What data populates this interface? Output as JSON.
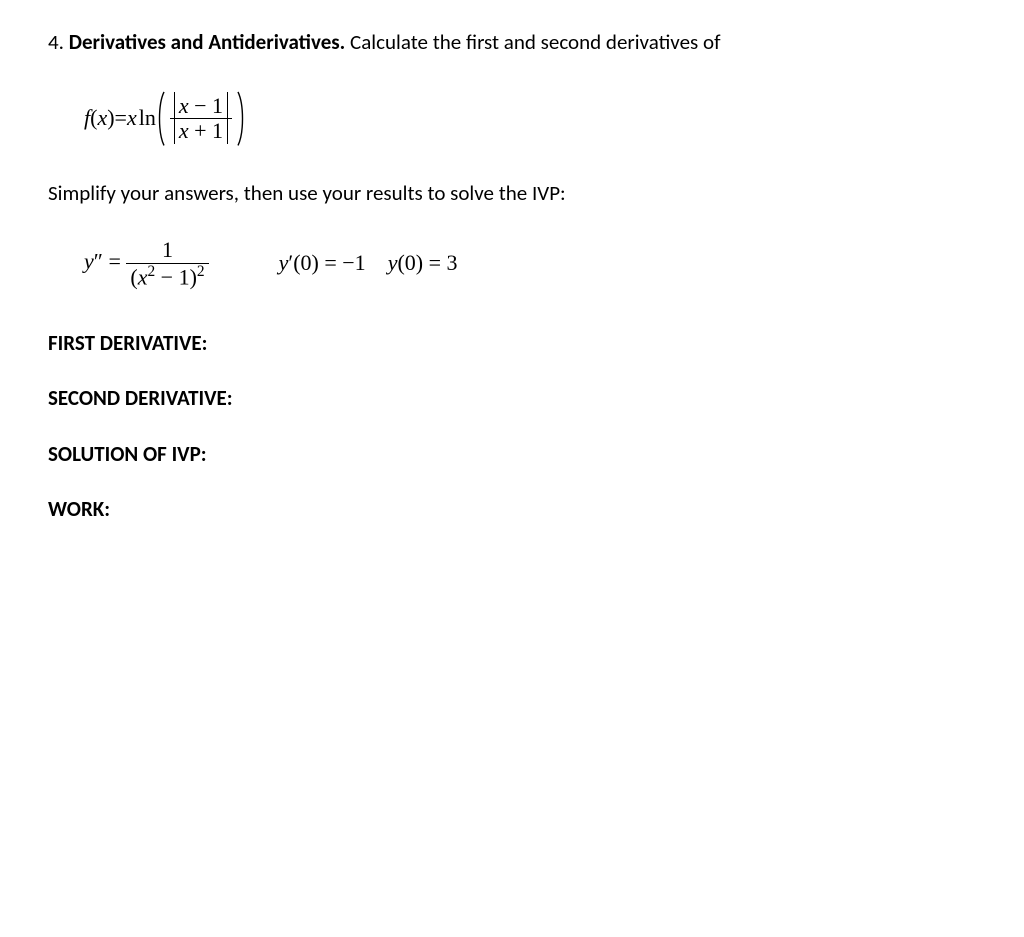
{
  "problem": {
    "number": "4.",
    "title": "Derivatives and Antiderivatives.",
    "prompt_rest": " Calculate the first and second derivatives of"
  },
  "eq1": {
    "lhs": "f",
    "lparen": "(",
    "var": "x",
    "rparen": ")",
    "equals": " = ",
    "factor": "x",
    "ln": "ln",
    "frac_num_left": "x",
    "frac_num_op": " − ",
    "frac_num_right": "1",
    "frac_den_left": "x",
    "frac_den_op": " + ",
    "frac_den_right": "1"
  },
  "instruction2": "Simplify your answers, then use your results to solve the IVP:",
  "ivp": {
    "lhs_y": "y",
    "lhs_primes": "″",
    "equals": " = ",
    "num": "1",
    "den_lp": "(",
    "den_x": "x",
    "den_sq": "2",
    "den_minus": " − ",
    "den_one": "1",
    "den_rp": ")",
    "den_outer_sq": "2",
    "cond1_y": "y",
    "cond1_prime": "′",
    "cond1_lp": "(",
    "cond1_arg": "0",
    "cond1_rp": ")",
    "cond1_eq": " = ",
    "cond1_val": "−1",
    "cond2_y": "y",
    "cond2_lp": "(",
    "cond2_arg": "0",
    "cond2_rp": ")",
    "cond2_eq": " = ",
    "cond2_val": "3"
  },
  "labels": {
    "first": "FIRST DERIVATIVE:",
    "second": "SECOND DERIVATIVE:",
    "solution": "SOLUTION OF IVP:",
    "work": "WORK:"
  }
}
